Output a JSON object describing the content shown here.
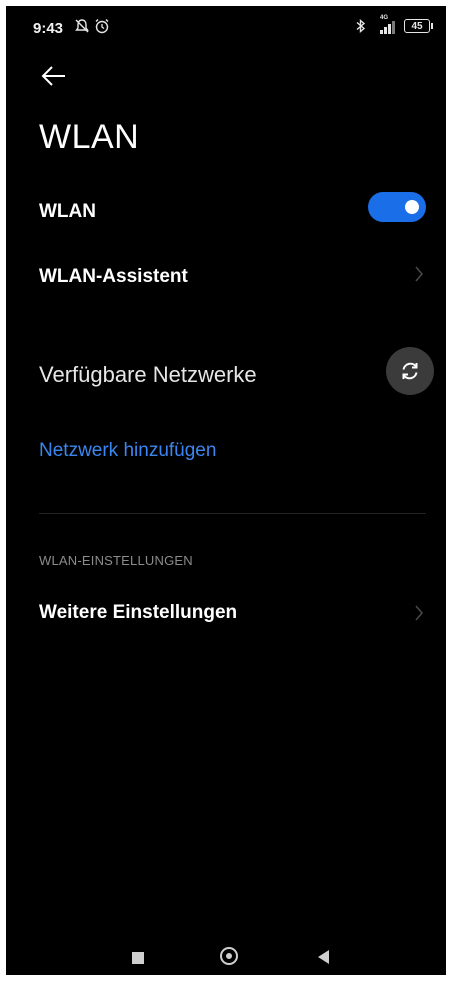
{
  "status_bar": {
    "time": "9:43",
    "network_type": "4G",
    "battery": "45"
  },
  "header": {
    "title": "WLAN"
  },
  "wlan_row": {
    "label": "WLAN",
    "toggle_on": true
  },
  "assistant_row": {
    "label": "WLAN-Assistent"
  },
  "available": {
    "label": "Verfügbare Netzwerke"
  },
  "add_network": {
    "label": "Netzwerk hinzufügen"
  },
  "settings_section": {
    "title": "WLAN-EINSTELLUNGEN",
    "more_label": "Weitere Einstellungen"
  },
  "colors": {
    "background": "#000000",
    "accent": "#1a6ee8",
    "link": "#3b86f0"
  }
}
